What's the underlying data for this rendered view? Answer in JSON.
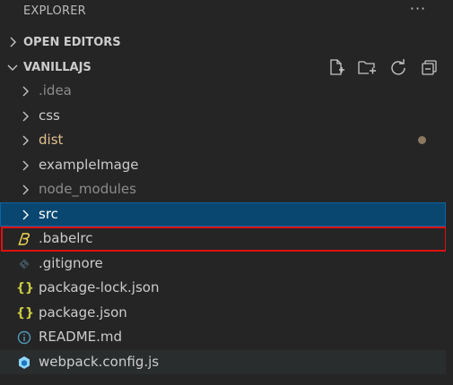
{
  "header": {
    "title": "EXPLORER",
    "more_label": "···"
  },
  "sections": {
    "open_editors": {
      "label": "OPEN EDITORS",
      "expanded": false
    },
    "project": {
      "label": "VANILLAJS",
      "expanded": true,
      "actions": [
        "new-file-icon",
        "new-folder-icon",
        "refresh-icon",
        "collapse-all-icon"
      ]
    }
  },
  "tree": {
    "items": [
      {
        "label": ".idea",
        "type": "folder",
        "state": "dimmed"
      },
      {
        "label": "css",
        "type": "folder",
        "state": "normal"
      },
      {
        "label": "dist",
        "type": "folder",
        "state": "modified"
      },
      {
        "label": "exampleImage",
        "type": "folder",
        "state": "normal"
      },
      {
        "label": "node_modules",
        "type": "folder",
        "state": "dimmed"
      },
      {
        "label": "src",
        "type": "folder",
        "state": "selected"
      },
      {
        "label": ".babelrc",
        "type": "file",
        "icon": "babel-icon",
        "state": "highlighted"
      },
      {
        "label": ".gitignore",
        "type": "file",
        "icon": "git-icon",
        "state": "normal"
      },
      {
        "label": "package-lock.json",
        "type": "file",
        "icon": "json-icon",
        "state": "normal"
      },
      {
        "label": "package.json",
        "type": "file",
        "icon": "json-icon",
        "state": "normal"
      },
      {
        "label": "README.md",
        "type": "file",
        "icon": "info-icon",
        "state": "normal"
      },
      {
        "label": "webpack.config.js",
        "type": "file",
        "icon": "webpack-icon",
        "state": "hover"
      }
    ]
  },
  "colors": {
    "background": "#252526",
    "selected": "#094771",
    "highlight_border": "#e01010",
    "modified_text": "#e2c08d",
    "dimmed_text": "#8c8c8c",
    "json_icon": "#cbcb41",
    "info_icon": "#519aba",
    "webpack_icon": "#8ed6fb",
    "babel_icon": "#f5da55"
  }
}
